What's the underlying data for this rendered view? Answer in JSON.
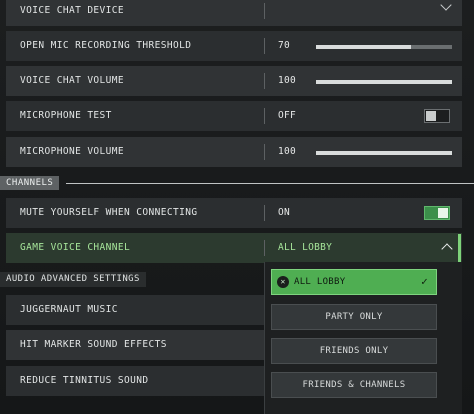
{
  "settings": {
    "voice_chat_device": {
      "label": "VOICE CHAT DEVICE",
      "value": ""
    },
    "open_mic_threshold": {
      "label": "OPEN MIC RECORDING THRESHOLD",
      "value": "70",
      "level_percent": 70
    },
    "voice_chat_volume": {
      "label": "VOICE CHAT VOLUME",
      "value": "100",
      "level_percent": 100
    },
    "microphone_test": {
      "label": "MICROPHONE TEST",
      "value": "OFF",
      "toggle_on": false
    },
    "microphone_volume": {
      "label": "MICROPHONE VOLUME",
      "value": "100",
      "level_percent": 100
    }
  },
  "channels": {
    "header": "CHANNELS",
    "mute_when_connecting": {
      "label": "MUTE YOURSELF WHEN CONNECTING",
      "value": "ON",
      "toggle_on": true
    },
    "game_voice_channel": {
      "label": "GAME VOICE CHANNEL",
      "value": "ALL LOBBY"
    }
  },
  "audio_advanced": {
    "header": "AUDIO ADVANCED SETTINGS",
    "items": [
      {
        "label": "JUGGERNAUT MUSIC"
      },
      {
        "label": "HIT MARKER SOUND EFFECTS"
      },
      {
        "label": "REDUCE TINNITUS SOUND"
      }
    ]
  },
  "dropdown": {
    "options": [
      {
        "label": "ALL LOBBY",
        "selected": true
      },
      {
        "label": "PARTY ONLY",
        "selected": false
      },
      {
        "label": "FRIENDS ONLY",
        "selected": false
      },
      {
        "label": "FRIENDS & CHANNELS",
        "selected": false
      }
    ]
  },
  "colors": {
    "accent_green": "#4fae52",
    "active_text": "#a6e59a",
    "row_bg": "#303335"
  }
}
